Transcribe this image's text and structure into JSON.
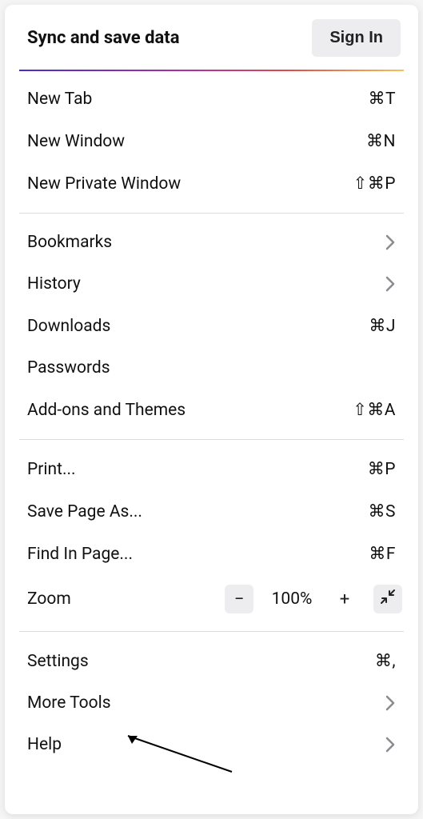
{
  "header": {
    "title": "Sync and save data",
    "signin": "Sign In"
  },
  "groups": {
    "g1": {
      "new_tab": {
        "label": "New Tab",
        "shortcut": "⌘T"
      },
      "new_window": {
        "label": "New Window",
        "shortcut": "⌘N"
      },
      "new_private": {
        "label": "New Private Window",
        "shortcut": "⇧⌘P"
      }
    },
    "g2": {
      "bookmarks": {
        "label": "Bookmarks"
      },
      "history": {
        "label": "History"
      },
      "downloads": {
        "label": "Downloads",
        "shortcut": "⌘J"
      },
      "passwords": {
        "label": "Passwords"
      },
      "addons": {
        "label": "Add-ons and Themes",
        "shortcut": "⇧⌘A"
      }
    },
    "g3": {
      "print": {
        "label": "Print...",
        "shortcut": "⌘P"
      },
      "save_as": {
        "label": "Save Page As...",
        "shortcut": "⌘S"
      },
      "find": {
        "label": "Find In Page...",
        "shortcut": "⌘F"
      },
      "zoom": {
        "label": "Zoom",
        "value": "100%"
      }
    },
    "g4": {
      "settings": {
        "label": "Settings",
        "shortcut": "⌘,"
      },
      "more_tools": {
        "label": "More Tools"
      },
      "help": {
        "label": "Help"
      }
    }
  }
}
